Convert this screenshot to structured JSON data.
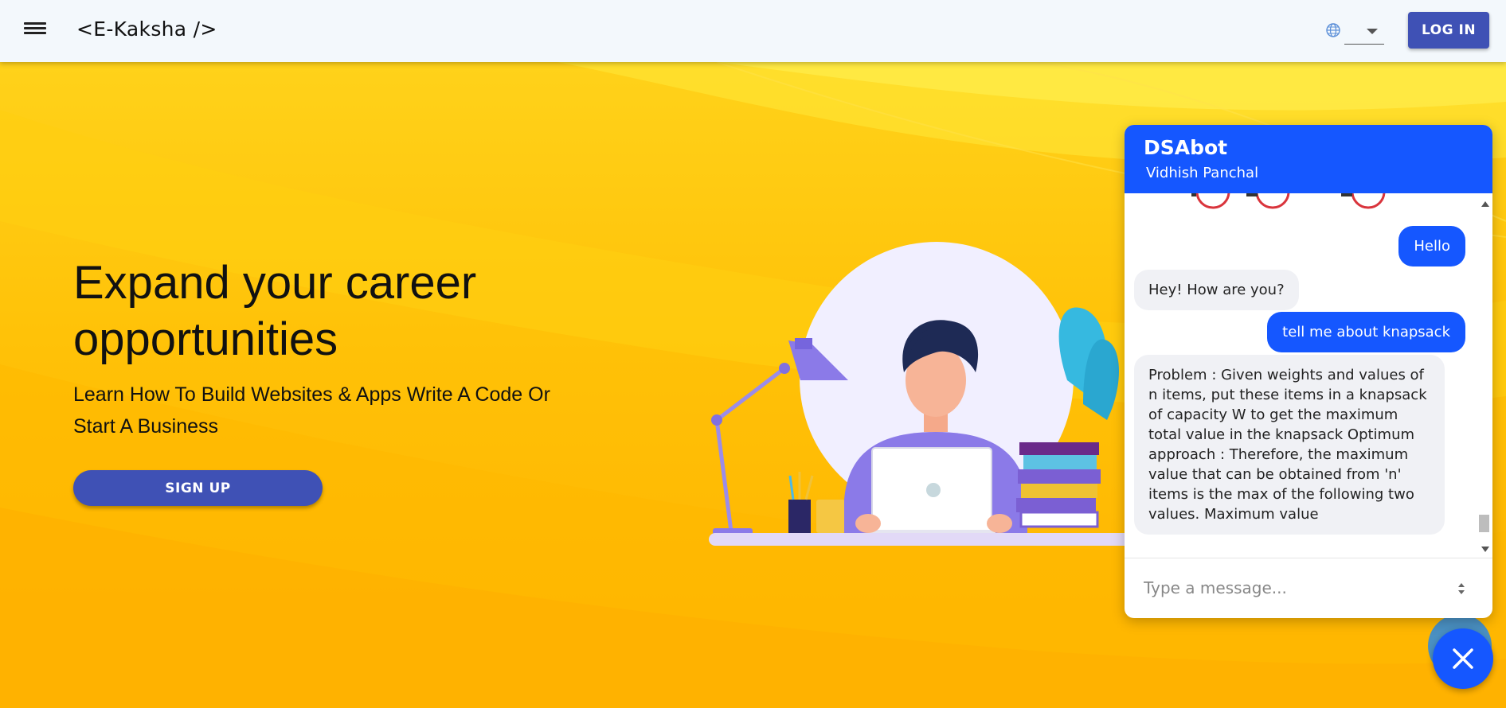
{
  "header": {
    "brand": "<E-Kaksha />",
    "menu_icon": "menu-icon",
    "globe_icon": "globe-icon",
    "language_value": "",
    "login_label": "LOG IN"
  },
  "hero": {
    "title": "Expand your career opportunities",
    "subtitle": "Learn How To Build Websites & Apps Write A Code Or Start A Business",
    "signup_label": "SIGN UP"
  },
  "chat": {
    "title": "DSAbot",
    "subtitle": "Vidhish Panchal",
    "messages": [
      {
        "from": "user",
        "text": "Hello"
      },
      {
        "from": "bot",
        "text": "Hey! How are you?"
      },
      {
        "from": "user",
        "text": "tell me about knapsack"
      },
      {
        "from": "bot",
        "text": "Problem : Given weights and values of n items, put these items in a knapsack of capacity W to get the maximum total value in the knapsack Optimum approach : Therefore, the maximum value that can be obtained from 'n' items is the max of the following two values. Maximum value"
      }
    ],
    "input_placeholder": "Type a message...",
    "close_icon": "close-icon"
  },
  "colors": {
    "accent": "#3f51b5",
    "chat_blue": "#1557ff",
    "hero_yellow": "#ffc107"
  }
}
